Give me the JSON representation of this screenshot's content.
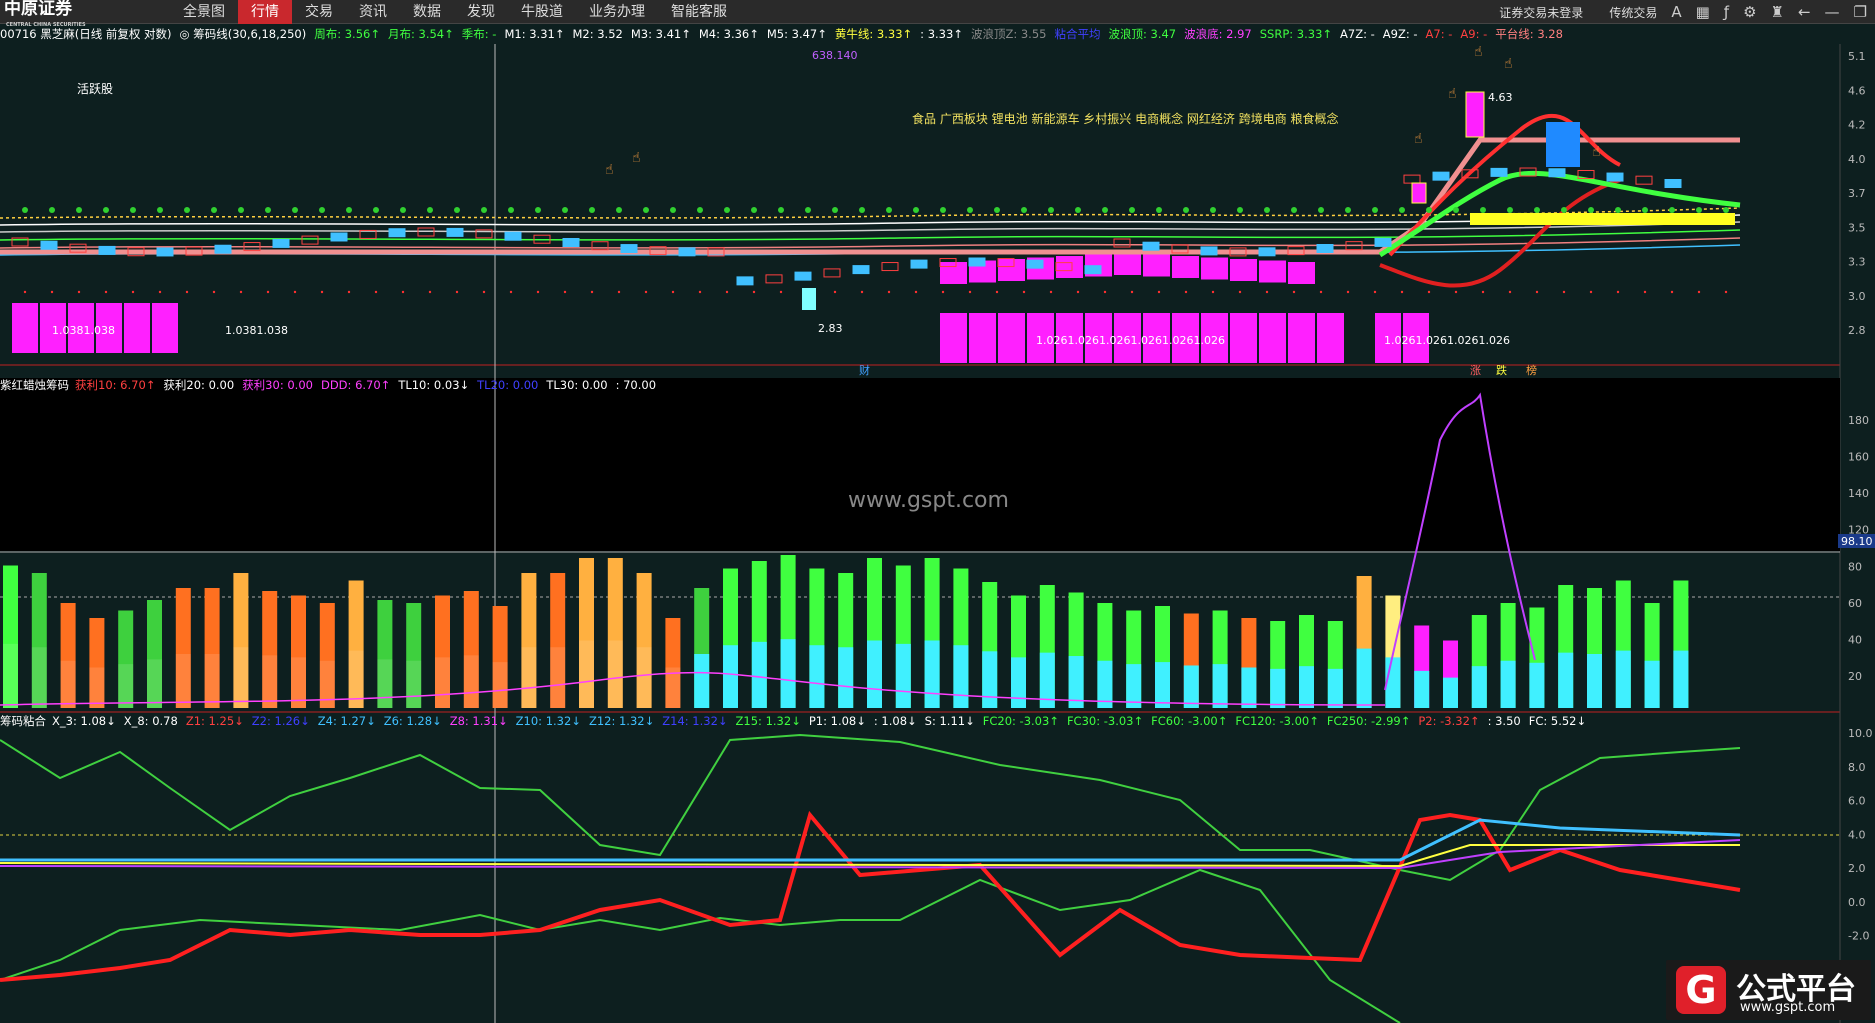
{
  "topbar": {
    "logo_cn": "中原证券",
    "logo_en": "CENTRAL CHINA SECURITIES",
    "menu": [
      {
        "label": "全景图",
        "active": false
      },
      {
        "label": "行情",
        "active": true
      },
      {
        "label": "交易",
        "active": false
      },
      {
        "label": "资讯",
        "active": false
      },
      {
        "label": "数据",
        "active": false
      },
      {
        "label": "发现",
        "active": false
      },
      {
        "label": "牛股道",
        "active": false
      },
      {
        "label": "业务办理",
        "active": false
      },
      {
        "label": "智能客服",
        "active": false
      }
    ],
    "login_status": "证券交易未登录",
    "mode": "传统交易",
    "icons": [
      "font-size-icon",
      "grid-icon",
      "formula-icon",
      "settings-icon",
      "shirt-icon",
      "back-icon",
      "minimize-icon",
      "restore-icon"
    ]
  },
  "infobar": {
    "items": [
      {
        "text": "00716 黑芝麻(日线 前复权 对数)",
        "color": "#ffffff"
      },
      {
        "text": "◎ 筹码线(30,6,18,250)",
        "color": "#ffffff"
      },
      {
        "text": "周布: 3.56↑",
        "color": "#40ff40"
      },
      {
        "text": "月布: 3.54↑",
        "color": "#40ff40"
      },
      {
        "text": "季布: -",
        "color": "#40ff40"
      },
      {
        "text": "M1: 3.31↑",
        "color": "#ffffff"
      },
      {
        "text": "M2: 3.52",
        "color": "#ffffff"
      },
      {
        "text": "M3: 3.41↑",
        "color": "#ffffff"
      },
      {
        "text": "M4: 3.36↑",
        "color": "#ffffff"
      },
      {
        "text": "M5: 3.47↑",
        "color": "#ffffff"
      },
      {
        "text": "黄牛线: 3.33↑",
        "color": "#ffff40"
      },
      {
        "text": ": 3.33↑",
        "color": "#ffffff"
      },
      {
        "text": "波浪顶Z: 3.55",
        "color": "#888888"
      },
      {
        "text": "粘合平均",
        "color": "#4040ff"
      },
      {
        "text": "波浪顶: 3.47",
        "color": "#40ff40"
      },
      {
        "text": "波浪底: 2.97",
        "color": "#ff40ff"
      },
      {
        "text": "SSRP: 3.33↑",
        "color": "#40ff40"
      },
      {
        "text": "A7Z: -",
        "color": "#ffffff"
      },
      {
        "text": "A9Z: -",
        "color": "#ffffff"
      },
      {
        "text": "A7: -",
        "color": "#ff4040"
      },
      {
        "text": "A9: -",
        "color": "#ff4040"
      },
      {
        "text": "平台线: 3.28",
        "color": "#ff8080"
      }
    ]
  },
  "main_panel": {
    "badge": "活跃股",
    "concepts": "食品 广西板块 锂电池 新能源车 乡村振兴 电商概念 网红经济 跨境电商 粮食概念",
    "high_label": "638.140",
    "peak_label": "4.63",
    "low_label": "2.83",
    "vol_left_1": "1.0381.038",
    "vol_left_2": "1.0381.038",
    "vol_mid": "1.0261.0261.0261.0261.0261.026",
    "vol_right": "1.0261.0261.0261.026",
    "marker_cai": "财",
    "marker_zhang": "涨",
    "marker_die": "跌",
    "marker_bang": "榜",
    "y_ticks": [
      "5.1",
      "4.6",
      "4.2",
      "4.0",
      "3.7",
      "3.5",
      "3.3",
      "3.0",
      "2.8"
    ]
  },
  "panel2": {
    "title": "紫红蜡烛筹码",
    "items": [
      {
        "text": "获利10: 6.70↑",
        "color": "#ff4040"
      },
      {
        "text": "获利20: 0.00",
        "color": "#ffffff"
      },
      {
        "text": "获利30: 0.00",
        "color": "#ff40ff"
      },
      {
        "text": "DDD: 6.70↑",
        "color": "#ff40ff"
      },
      {
        "text": "TL10: 0.03↓",
        "color": "#ffffff"
      },
      {
        "text": "TL20: 0.00",
        "color": "#4040ff"
      },
      {
        "text": "TL30: 0.00",
        "color": "#ffffff"
      },
      {
        "text": ": 70.00",
        "color": "#ffffff"
      }
    ],
    "watermark": "www.gspt.com",
    "current_value": "98.10",
    "y_ticks": [
      "180",
      "160",
      "140",
      "120",
      "80",
      "60",
      "40",
      "20"
    ]
  },
  "panel3": {
    "title": "筹码粘合",
    "items": [
      {
        "text": "X_3: 1.08↓",
        "color": "#ffffff"
      },
      {
        "text": "X_8: 0.78",
        "color": "#ffffff"
      },
      {
        "text": "Z1: 1.25↓",
        "color": "#ff4040"
      },
      {
        "text": "Z2: 1.26↓",
        "color": "#4040ff"
      },
      {
        "text": "Z4: 1.27↓",
        "color": "#40c0ff"
      },
      {
        "text": "Z6: 1.28↓",
        "color": "#40c0ff"
      },
      {
        "text": "Z8: 1.31↓",
        "color": "#ff40ff"
      },
      {
        "text": "Z10: 1.32↓",
        "color": "#40c0ff"
      },
      {
        "text": "Z12: 1.32↓",
        "color": "#40c0ff"
      },
      {
        "text": "Z14: 1.32↓",
        "color": "#4040ff"
      },
      {
        "text": "Z15: 1.32↓",
        "color": "#40ff40"
      },
      {
        "text": "P1: 1.08↓",
        "color": "#ffffff"
      },
      {
        "text": ": 1.08↓",
        "color": "#ffffff"
      },
      {
        "text": "S: 1.11↓",
        "color": "#ffffff"
      },
      {
        "text": "FC20: -3.03↑",
        "color": "#40ff40"
      },
      {
        "text": "FC30: -3.03↑",
        "color": "#40ff40"
      },
      {
        "text": "FC60: -3.00↑",
        "color": "#40ff40"
      },
      {
        "text": "FC120: -3.00↑",
        "color": "#40ff40"
      },
      {
        "text": "FC250: -2.99↑",
        "color": "#40ff40"
      },
      {
        "text": "P2: -3.32↑",
        "color": "#ff4040"
      },
      {
        "text": ": 3.50",
        "color": "#ffffff"
      },
      {
        "text": "FC: 5.52↓",
        "color": "#ffffff"
      }
    ],
    "y_ticks": [
      "10.0",
      "8.0",
      "6.0",
      "4.0",
      "2.0",
      "0.0",
      "-2.0",
      "-4.0",
      "-6.0"
    ]
  },
  "corner_logo": {
    "name": "公式平台",
    "site": "www.gspt.com"
  }
}
